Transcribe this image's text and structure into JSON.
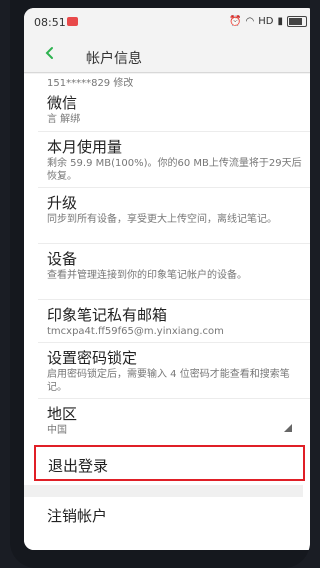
{
  "status": {
    "time": "08:51",
    "network": "HD"
  },
  "appbar": {
    "title": "帐户信息"
  },
  "partial_row": {
    "text": "151*****829  修改"
  },
  "items": [
    {
      "title": "微信",
      "subtitle": "言 解绑"
    },
    {
      "title": "本月使用量",
      "subtitle": "剩余 59.9 MB(100%)。你的60 MB上传流量将于29天后恢复。"
    },
    {
      "title": "升级",
      "subtitle": "同步到所有设备，享受更大上传空间，离线记笔记。"
    },
    {
      "title": "设备",
      "subtitle": "查看并管理连接到你的印象笔记帐户的设备。"
    },
    {
      "title": "印象笔记私有邮箱",
      "subtitle": "tmcxpa4t.ff59f65@m.yinxiang.com"
    },
    {
      "title": "设置密码锁定",
      "subtitle": "启用密码锁定后，需要输入 4 位密码才能查看和搜索笔记。"
    },
    {
      "title": "地区",
      "subtitle": "中国"
    }
  ],
  "actions": {
    "logout": "退出登录",
    "cancel_account": "注销帐户"
  },
  "colors": {
    "highlight": "#e01f26",
    "back_arrow": "#2db24f"
  }
}
